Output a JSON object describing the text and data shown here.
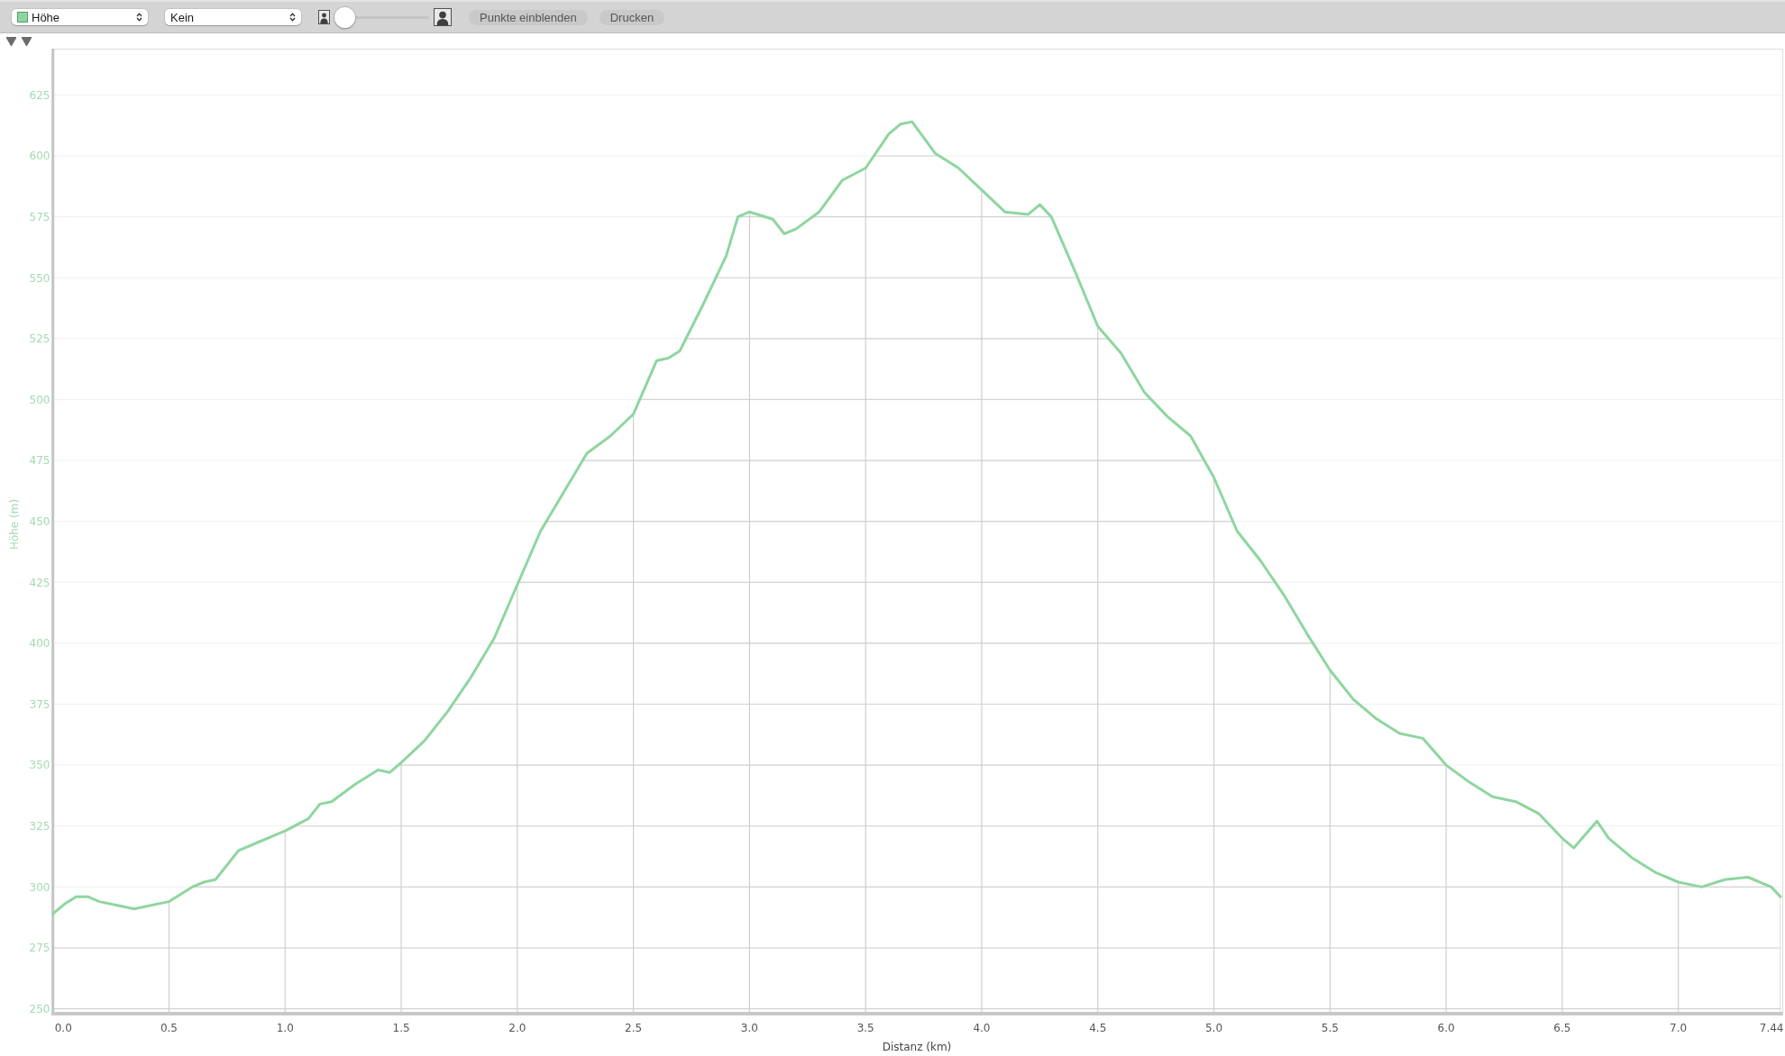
{
  "toolbar": {
    "selects": [
      {
        "kind": "swatch",
        "value": "Höhe"
      },
      {
        "kind": "plain",
        "value": "Kein"
      }
    ],
    "zoom_slider": {
      "level": 0
    },
    "buttons": [
      "Punkte einblenden",
      "Drucken"
    ]
  },
  "chart": {
    "chart_data": {
      "type": "line",
      "xlabel": "Distanz (km)",
      "ylabel": "Höhe (m)",
      "grid": true,
      "x": [
        0,
        0.05,
        0.1,
        0.15,
        0.2,
        0.3,
        0.35,
        0.4,
        0.5,
        0.6,
        0.65,
        0.7,
        0.8,
        0.9,
        0.95,
        1.0,
        1.1,
        1.15,
        1.2,
        1.3,
        1.4,
        1.45,
        1.5,
        1.6,
        1.7,
        1.8,
        1.9,
        2.0,
        2.1,
        2.2,
        2.3,
        2.4,
        2.5,
        2.6,
        2.65,
        2.7,
        2.8,
        2.9,
        2.95,
        3.0,
        3.1,
        3.15,
        3.2,
        3.3,
        3.4,
        3.5,
        3.6,
        3.65,
        3.7,
        3.8,
        3.9,
        4.0,
        4.1,
        4.2,
        4.25,
        4.3,
        4.4,
        4.5,
        4.6,
        4.7,
        4.8,
        4.9,
        5.0,
        5.1,
        5.2,
        5.3,
        5.4,
        5.5,
        5.6,
        5.7,
        5.8,
        5.9,
        6.0,
        6.1,
        6.2,
        6.3,
        6.4,
        6.5,
        6.55,
        6.65,
        6.7,
        6.8,
        6.9,
        7.0,
        7.1,
        7.2,
        7.3,
        7.4,
        7.44
      ],
      "series": [
        {
          "color": "#8ed69f",
          "values": [
            289,
            293,
            296,
            296,
            294,
            292,
            291,
            292,
            294,
            300,
            302,
            303,
            315,
            319,
            321,
            323,
            328,
            334,
            335,
            342,
            348,
            347,
            351,
            360,
            372,
            386,
            402,
            424,
            446,
            462,
            478,
            485,
            494,
            516,
            517,
            520,
            539,
            559,
            575,
            577,
            574,
            568,
            570,
            577,
            590,
            595,
            609,
            613,
            614,
            601,
            595,
            586,
            577,
            576,
            580,
            575,
            553,
            530,
            519,
            503,
            493,
            485,
            468,
            446,
            434,
            420,
            404,
            389,
            377,
            369,
            363,
            361,
            350,
            343,
            337,
            335,
            330,
            320,
            316,
            327,
            320,
            312,
            306,
            302,
            300,
            303,
            304,
            300,
            296
          ]
        }
      ],
      "xlim": [
        0,
        7.44
      ],
      "ylim": [
        248,
        644
      ],
      "xticks": [
        {
          "value": 0,
          "label": "0.0"
        },
        {
          "value": 0.5,
          "label": "0.5"
        },
        {
          "value": 1,
          "label": "1.0"
        },
        {
          "value": 1.5,
          "label": "1.5"
        },
        {
          "value": 2,
          "label": "2.0"
        },
        {
          "value": 2.5,
          "label": "2.5"
        },
        {
          "value": 3,
          "label": "3.0"
        },
        {
          "value": 3.5,
          "label": "3.5"
        },
        {
          "value": 4,
          "label": "4.0"
        },
        {
          "value": 4.5,
          "label": "4.5"
        },
        {
          "value": 5,
          "label": "5.0"
        },
        {
          "value": 5.5,
          "label": "5.5"
        },
        {
          "value": 6,
          "label": "6.0"
        },
        {
          "value": 6.5,
          "label": "6.5"
        },
        {
          "value": 7,
          "label": "7.0"
        },
        {
          "value": 7.44,
          "label": "7.44"
        }
      ],
      "yticks": [
        250,
        275,
        300,
        325,
        350,
        375,
        400,
        425,
        450,
        475,
        500,
        525,
        550,
        575,
        600,
        625
      ]
    }
  }
}
